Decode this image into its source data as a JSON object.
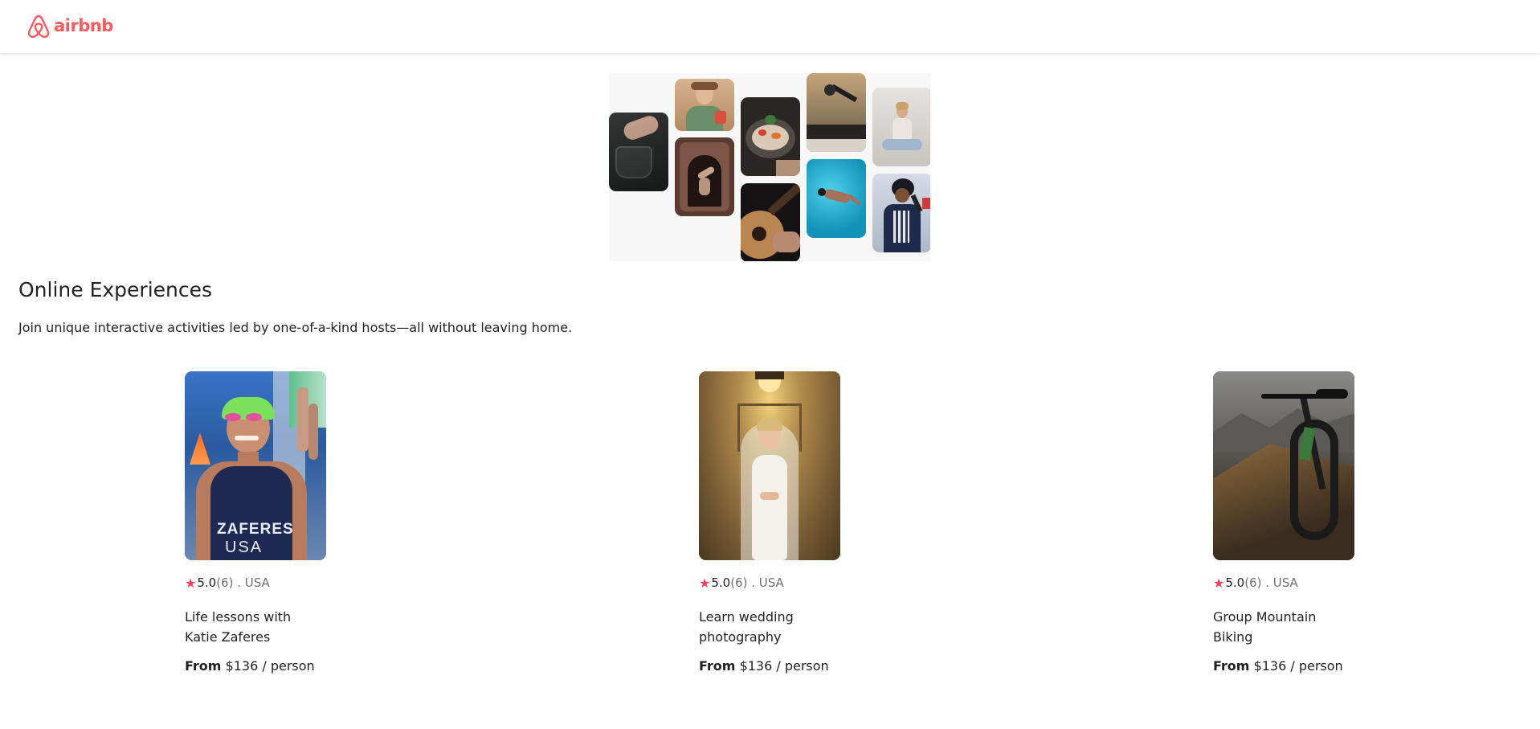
{
  "brand": {
    "name": "airbnb",
    "color": "#FF5A5F",
    "icon": "airbnb-belo-icon"
  },
  "section": {
    "title": "Online Experiences",
    "subtitle": "Join unique interactive activities led by one-of-a-kind hosts—all without leaving home."
  },
  "cards": [
    {
      "rating": "5.0",
      "count": "(6)",
      "separator": " . ",
      "country": "USA",
      "title": "Life lessons with Katie Zaferes",
      "from": "From",
      "price": "$136",
      "unit": "/ person"
    },
    {
      "rating": "5.0",
      "count": "(6)",
      "separator": " . ",
      "country": "USA",
      "title": "Learn wedding photography",
      "from": "From",
      "price": "$136",
      "unit": "/ person"
    },
    {
      "rating": "5.0",
      "count": "(6)",
      "separator": " . ",
      "country": "USA",
      "title": "Group Mountain Biking",
      "from": "From",
      "price": "$136",
      "unit": "/ person"
    }
  ],
  "colors": {
    "star": "#FF385C",
    "muted": "#717171",
    "text": "#222222"
  }
}
